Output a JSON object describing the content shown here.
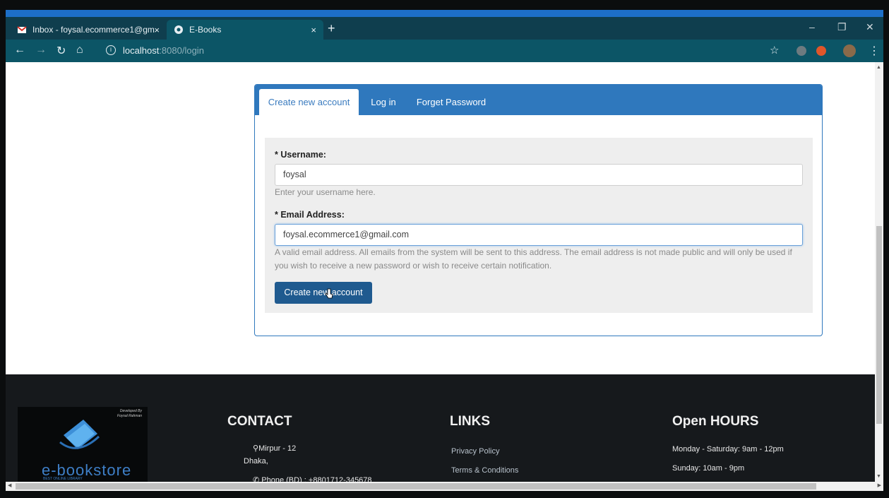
{
  "browser": {
    "tabs": [
      {
        "label": "Inbox - foysal.ecommerce1@gm",
        "icon": "gmail-icon"
      },
      {
        "label": "E-Books",
        "icon": "chrome-icon"
      }
    ],
    "close_glyph": "×",
    "new_tab_glyph": "+",
    "url_host": "localhost",
    "url_path": ":8080/login"
  },
  "panel": {
    "tabs": [
      "Create new account",
      "Log in",
      "Forget Password"
    ],
    "active_tab": "Create new account",
    "username_label": "* Username:",
    "username_value": "foysal",
    "username_help": "Enter your username here.",
    "email_label": "* Email Address:",
    "email_value": "foysal.ecommerce1@gmail.com",
    "email_help": "A valid email address. All emails from the system will be sent to this address. The email address is not made public and will only be used if you wish to receive a new password or wish to receive certain notification.",
    "submit_label": "Create new account"
  },
  "footer": {
    "logo": {
      "word": "e-bookstore",
      "sub": "BEST ONLINE LIBRARY",
      "dev": "Developed By\nFoysal Rahman"
    },
    "contact_title": "CONTACT",
    "contact_lines": [
      "Mirpur - 12",
      "Dhaka,",
      "Phone (BD) : +8801712-345678"
    ],
    "links_title": "LINKS",
    "links": [
      "Privacy Policy",
      "Terms & Conditions"
    ],
    "hours_title": "Open HOURS",
    "hours": [
      "Monday - Saturday: 9am - 12pm",
      "Sunday: 10am - 9pm"
    ]
  },
  "colors": {
    "accent": "#2f78bd",
    "button": "#1f5a8f",
    "footer_bg": "#16191c",
    "browser_bar": "#0c5566"
  }
}
